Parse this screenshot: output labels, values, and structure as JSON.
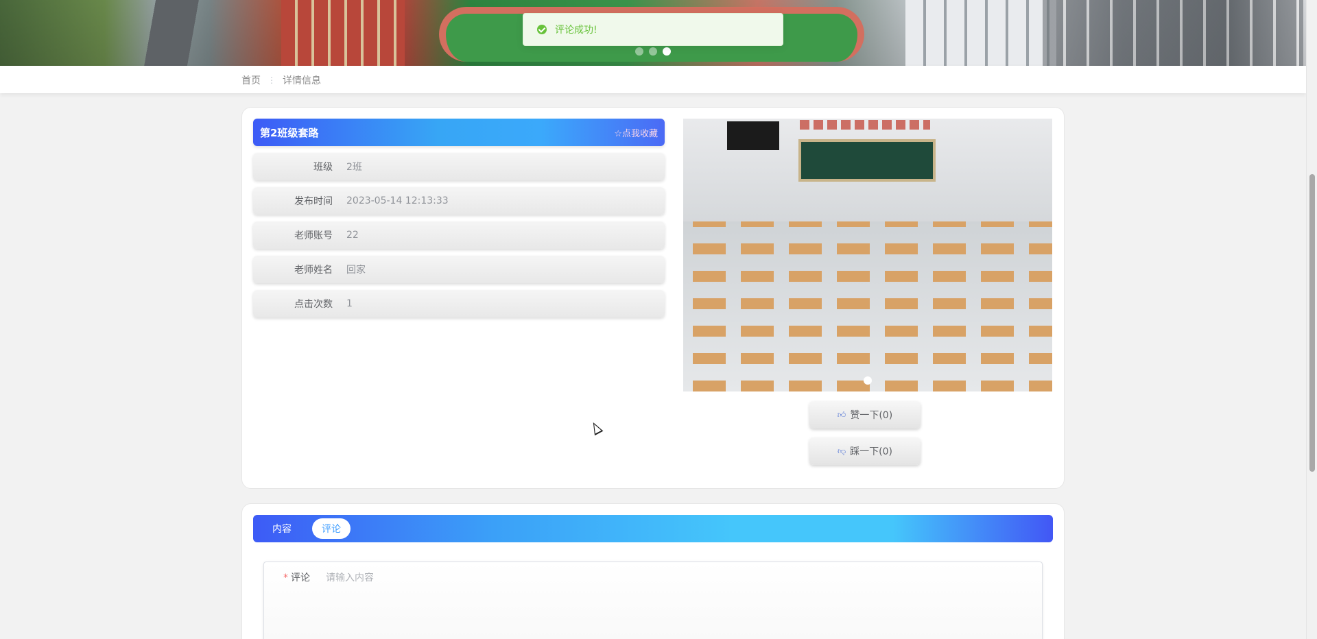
{
  "toast": {
    "message": "评论成功!",
    "icon": "success-check-icon",
    "color": "#67c23a"
  },
  "banner": {
    "slide_count": 3,
    "active_slide": 3
  },
  "breadcrumb": {
    "home": "首页",
    "current": "详情信息"
  },
  "detail": {
    "title": "第2班级套路",
    "collect_label": "☆点我收藏",
    "fields": [
      {
        "label": "班级",
        "value": "2班"
      },
      {
        "label": "发布时间",
        "value": "2023-05-14 12:13:33"
      },
      {
        "label": "老师账号",
        "value": "22"
      },
      {
        "label": "老师姓名",
        "value": "回家"
      },
      {
        "label": "点击次数",
        "value": "1"
      }
    ],
    "like_label": "赞一下(0)",
    "dislike_label": "踩一下(0)"
  },
  "tabs": [
    {
      "label": "内容",
      "active": false
    },
    {
      "label": "评论",
      "active": true
    }
  ],
  "comment_form": {
    "label": "评论",
    "required_mark": "*",
    "placeholder": "请输入内容",
    "value": ""
  },
  "colors": {
    "primary_gradient_start": "#3d5bf6",
    "primary_gradient_mid": "#45c6fb",
    "tab_active_text": "#409eff",
    "required": "#f56c6c"
  }
}
